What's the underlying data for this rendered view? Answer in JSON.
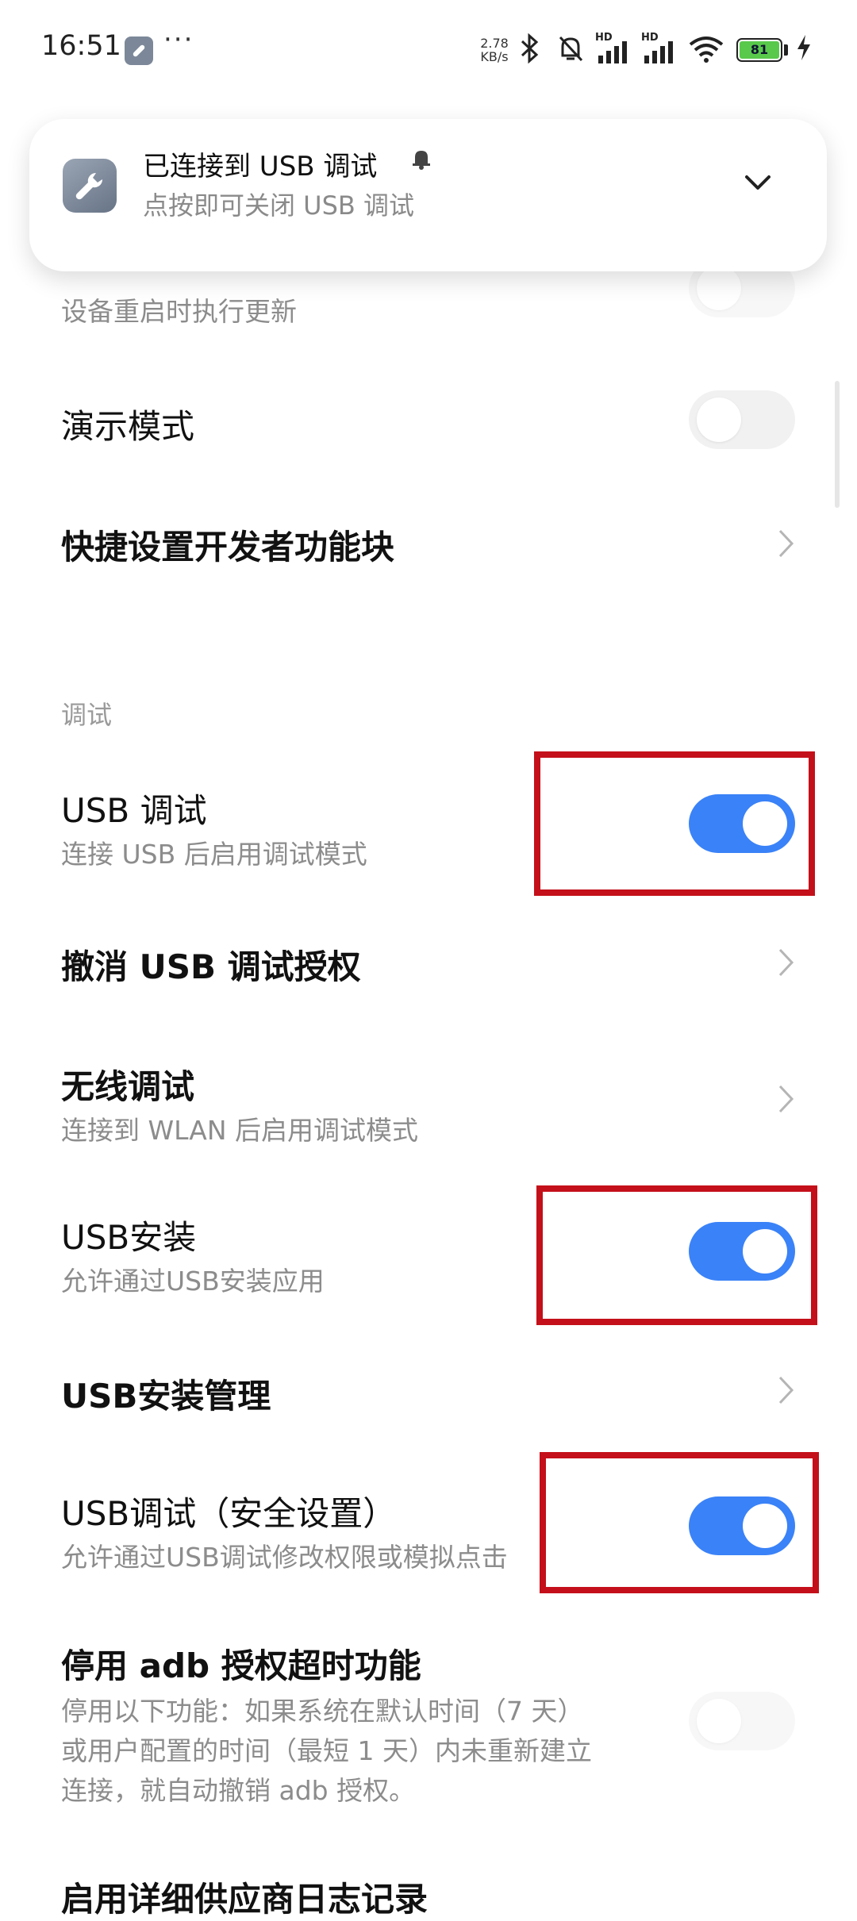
{
  "status_bar": {
    "time": "16:51",
    "more": "···",
    "speed_value": "2.78",
    "speed_unit": "KB/s",
    "hd_1": "HD",
    "hd_2": "HD",
    "battery_level": "81",
    "icons": [
      "wrench-icon",
      "bluetooth-icon",
      "mute-bell-icon",
      "signal-icon",
      "signal-icon",
      "wifi-icon",
      "battery-icon",
      "charging-icon"
    ]
  },
  "notification": {
    "title": "已连接到 USB 调试",
    "subtitle": "点按即可关闭 USB 调试"
  },
  "partial_item": {
    "subtitle": "设备重启时执行更新",
    "toggle_on": false
  },
  "items_top": [
    {
      "title": "演示模式",
      "type": "toggle",
      "on": false
    },
    {
      "title": "快捷设置开发者功能块",
      "type": "link"
    }
  ],
  "section": {
    "header": "调试"
  },
  "debug_items": [
    {
      "title": "USB 调试",
      "subtitle": "连接 USB 后启用调试模式",
      "type": "toggle",
      "on": true
    },
    {
      "title": "撤消 USB 调试授权",
      "type": "link"
    },
    {
      "title": "无线调试",
      "subtitle": "连接到 WLAN 后启用调试模式",
      "type": "link"
    },
    {
      "title": "USB安装",
      "subtitle": "允许通过USB安装应用",
      "type": "toggle",
      "on": true
    },
    {
      "title": "USB安装管理",
      "type": "link"
    },
    {
      "title": "USB调试（安全设置）",
      "subtitle": "允许通过USB调试修改权限或模拟点击",
      "type": "toggle",
      "on": true
    },
    {
      "title": "停用 adb 授权超时功能",
      "subtitle_lines": [
        "停用以下功能：如果系统在默认时间（7 天）",
        "或用户配置的时间（最短 1 天）内未重新建立",
        "连接，就自动撤销 adb 授权。"
      ],
      "type": "toggle",
      "on": false
    },
    {
      "title": "启用详细供应商日志记录",
      "type": "partial"
    }
  ],
  "colors": {
    "accent": "#3a82f7",
    "highlight_border": "#c4101a",
    "battery_fill": "#59c94b"
  }
}
